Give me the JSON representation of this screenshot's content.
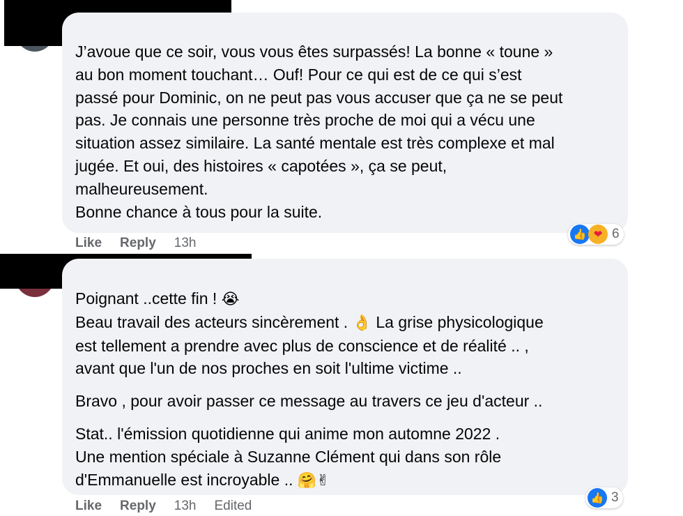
{
  "comments": [
    {
      "lines": [
        "J’avoue que ce soir, vous vous êtes surpassés! La bonne « toune »",
        "au bon moment touchant… Ouf! Pour ce qui est de ce qui s’est",
        "passé pour Dominic, on ne peut pas vous accuser que ça ne se peut",
        "pas. Je connais une personne très proche de moi qui a vécu une",
        "situation assez similaire. La santé mentale est très complexe et mal",
        "jugée. Et oui, des histoires « capotées », ça se peut,",
        "malheureusement.",
        "Bonne chance à tous pour la suite."
      ],
      "actions": {
        "like": "Like",
        "reply": "Reply",
        "time": "13h"
      },
      "reactions": {
        "count": "6",
        "icons": [
          "like-icon",
          "care-icon"
        ]
      }
    },
    {
      "p1_l1": "Poignant ..cette fin ! ",
      "p1_l1_emoji": "😭",
      "p1_l2a": "Beau travail des acteurs sincèrement . ",
      "p1_l2_emoji": "👌",
      "p1_l2b": " La grise physicologique",
      "p1_l3": "est tellement a prendre avec plus de conscience et de réalité .. ,",
      "p1_l4": "avant que l'un de nos proches en soit l'ultime victime ..",
      "p2": "Bravo , pour avoir passer ce message au travers ce jeu d'acteur ..",
      "p3_l1": "Stat.. l'émission quotidienne qui anime mon automne 2022 .",
      "p3_l2": "Une mention spéciale à Suzanne Clément qui dans son rôle",
      "p3_l3": "d'Emmanuelle est incroyable .. ",
      "p3_l3_emoji": "🤗✌",
      "actions": {
        "like": "Like",
        "reply": "Reply",
        "time": "13h",
        "edited": "Edited"
      },
      "reactions": {
        "count": "3",
        "icons": [
          "like-icon"
        ]
      }
    }
  ],
  "colors": {
    "bubble": "#f0f2f5",
    "secondary_text": "#65676b",
    "like_blue": "#1877f2"
  }
}
